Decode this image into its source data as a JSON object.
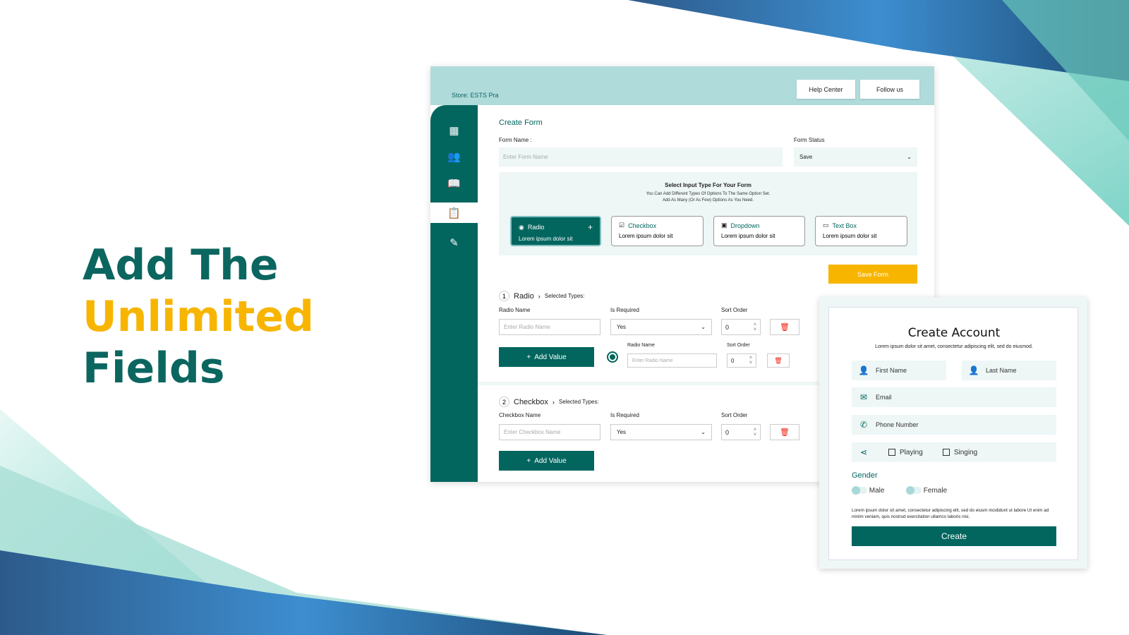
{
  "headline": {
    "line1": "Add The",
    "line2": "Unlimited",
    "line3": "Fields"
  },
  "colors": {
    "teal": "#02665f",
    "accent_yellow": "#f7b500",
    "header_bg": "#b0dbdb",
    "delete_red": "#e21b1b"
  },
  "header": {
    "store": "Store: ESTS Pra",
    "help_center": "Help Center",
    "follow_us": "Follow us"
  },
  "sidebar": {
    "items": [
      {
        "icon": "dashboard-icon"
      },
      {
        "icon": "users-icon"
      },
      {
        "icon": "book-icon"
      },
      {
        "icon": "clipboard-icon",
        "active": true
      },
      {
        "icon": "edit-icon"
      }
    ]
  },
  "form": {
    "title": "Create Form",
    "name_label": "Form Name :",
    "name_placeholder": "Enter Form Name",
    "status_label": "Form Status",
    "status_value": "Save",
    "input_type": {
      "title": "Select Input Type For Your Form",
      "desc1": "You Can Add Different Types Of Options To The Same Option Set.",
      "desc2": "Add As Many (Or As Few) Options As You Need.",
      "cards": [
        {
          "name": "Radio",
          "desc": "Lorem ipsum dolor sit",
          "icon": "radio-icon",
          "selected": true
        },
        {
          "name": "Checkbox",
          "desc": "Lorem ipsum dolor sit",
          "icon": "checkbox-icon"
        },
        {
          "name": "Dropdown",
          "desc": "Lorem ipsum dolor sit",
          "icon": "dropdown-icon"
        },
        {
          "name": "Text Box",
          "desc": "Lorem ipsum dolor sit",
          "icon": "textbox-icon"
        }
      ]
    },
    "save_label": "Save Form",
    "sections": [
      {
        "num": "1",
        "type": "Radio",
        "selected": "Selected Types:",
        "name_label": "Radio Name",
        "name_placeholder": "Enter Radio Name",
        "required_label": "Is Required",
        "required_value": "Yes",
        "sort_label": "Sort Order",
        "sort_value": "0",
        "add_value": "Add Value",
        "value_row": {
          "name_label": "Radio Name",
          "name_placeholder": "Enter Radio Name",
          "sort_label": "Sort Order",
          "sort_value": "0"
        }
      },
      {
        "num": "2",
        "type": "Checkbox",
        "selected": "Selected Types:",
        "name_label": "Checkbox Name",
        "name_placeholder": "Enter Checkbox Name",
        "required_label": "Is Required",
        "required_value": "Yes",
        "sort_label": "Sort Order",
        "sort_value": "0",
        "add_value": "Add Value"
      }
    ]
  },
  "account": {
    "title": "Create Account",
    "subtitle": "Lorem ipsum dolor sit amet, consectetur adipiscing elit, sed do eiusmod.",
    "first_name": "First Name",
    "last_name": "Last Name",
    "email": "Email",
    "phone": "Phone Number",
    "hobbies": [
      "Playing",
      "Singing"
    ],
    "gender_label": "Gender",
    "genders": [
      "Male",
      "Female"
    ],
    "terms": "Lorem ipsum dolor sit amet, consectetur adipiscing elit, sed do eiusm incididunt ut labore Ut enim ad minim veniam, quis nostrud exercitation ullamco laboris nisi.",
    "create": "Create"
  }
}
